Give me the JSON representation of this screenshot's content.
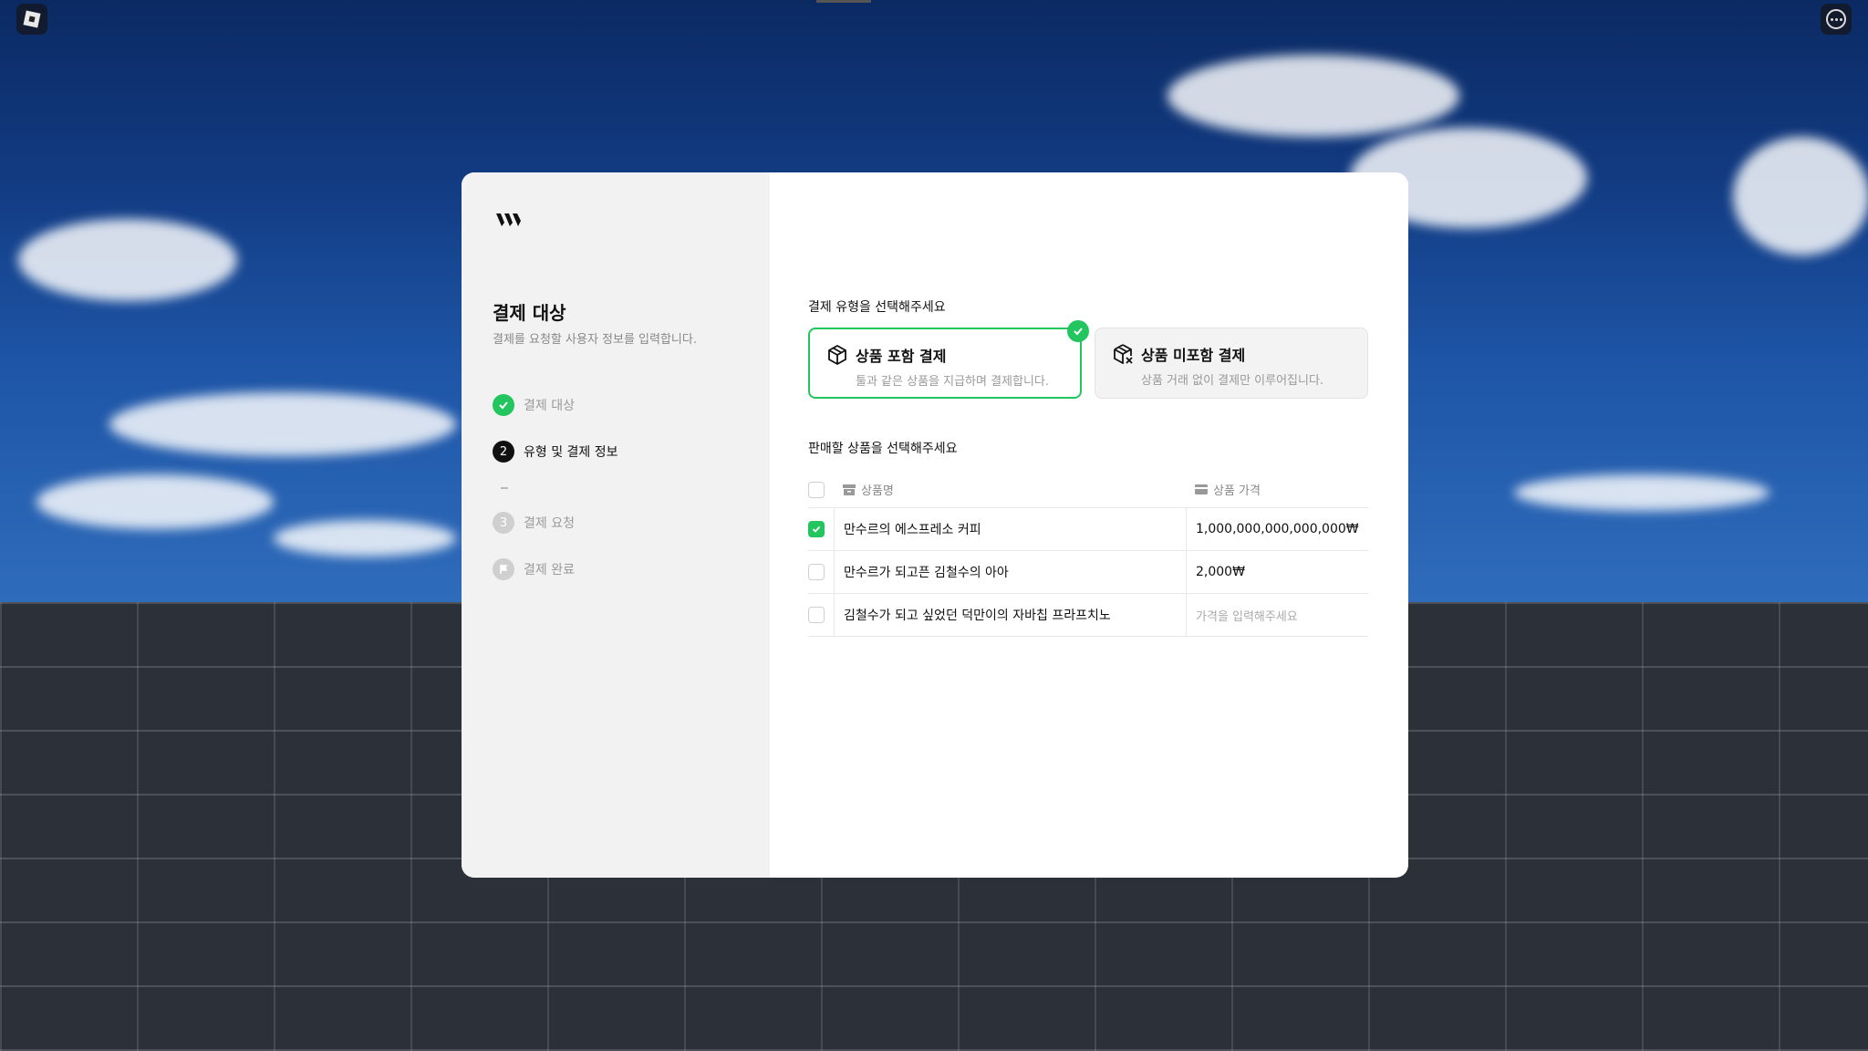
{
  "left": {
    "title": "결제 대상",
    "description": "결제를 요청할 사용자 정보를 입력합니다.",
    "steps": [
      {
        "label": "결제 대상",
        "state": "done",
        "marker": ""
      },
      {
        "label": "유형 및 결제 정보",
        "state": "active",
        "marker": "2"
      },
      {
        "label": "결제 요청",
        "state": "pending",
        "marker": "3"
      },
      {
        "label": "결제 완료",
        "state": "pending",
        "marker": ""
      }
    ]
  },
  "right": {
    "type_section_title": "결제 유형을 선택해주세요",
    "type_cards": [
      {
        "title": "상품 포함 결제",
        "description": "툴과 같은 상품을 지급하며 결제합니다.",
        "selected": true
      },
      {
        "title": "상품 미포함 결제",
        "description": "상품 거래 없이 결제만 이루어집니다.",
        "selected": false
      }
    ],
    "product_section_title": "판매할 상품을 선택해주세요",
    "table": {
      "headers": {
        "name": "상품명",
        "price": "상품 가격"
      },
      "rows": [
        {
          "name": "만수르의 에스프레소 커피",
          "price": "1,000,000,000,000,000₩",
          "checked": true
        },
        {
          "name": "만수르가 되고픈 김철수의 아아",
          "price": "2,000₩",
          "checked": false
        },
        {
          "name": "김철수가 되고 싶었던 덕만이의 자바칩 프라프치노",
          "price": "",
          "placeholder": "가격을 입력해주세요",
          "checked": false
        }
      ]
    }
  },
  "colors": {
    "accent": "#22c55e",
    "panel": "#f2f2f2"
  }
}
